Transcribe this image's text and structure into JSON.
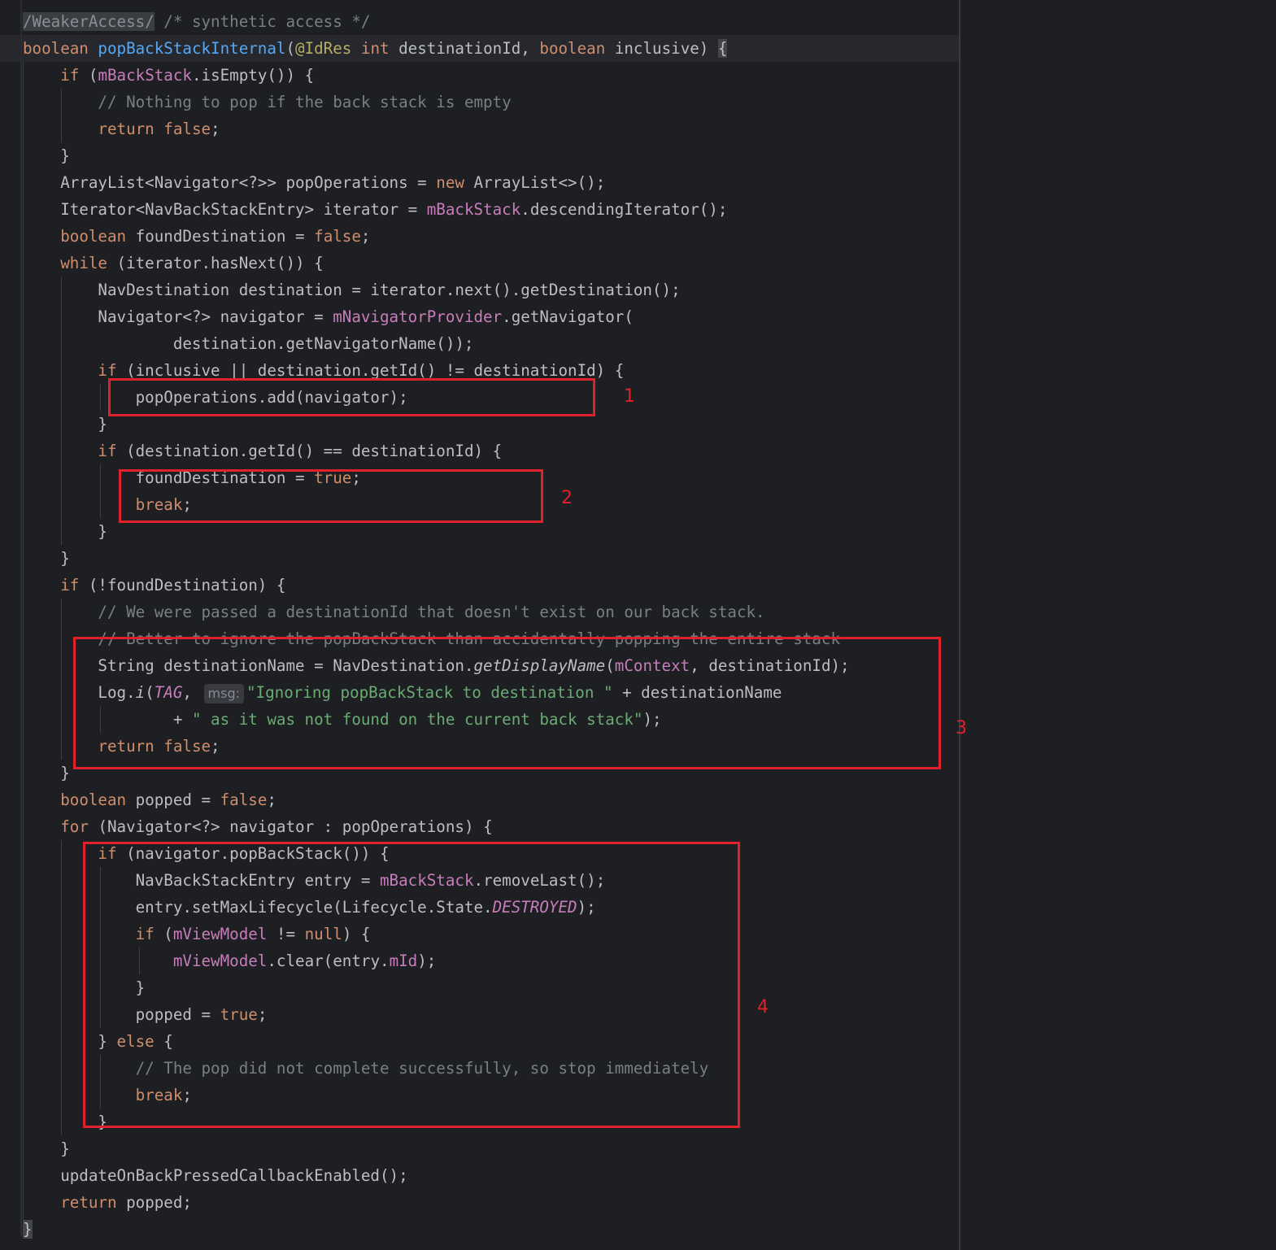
{
  "lines": [
    [
      [
        "hl-sup",
        "/WeakerAccess/"
      ],
      [
        "cmt",
        " /* synthetic access */"
      ]
    ],
    [
      [
        "kw",
        "boolean "
      ],
      [
        "fn",
        "popBackStackInternal"
      ],
      [
        "",
        "("
      ],
      [
        "ann",
        "@IdRes "
      ],
      [
        "kw",
        "int "
      ],
      [
        "",
        "destinationId, "
      ],
      [
        "kw",
        "boolean "
      ],
      [
        "",
        "inclusive) "
      ],
      [
        "brace-hl",
        "{"
      ]
    ],
    [
      [
        "",
        "    "
      ],
      [
        "kw",
        "if "
      ],
      [
        "",
        "("
      ],
      [
        "fld",
        "mBackStack"
      ],
      [
        "",
        ".isEmpty()) {"
      ]
    ],
    [
      [
        "",
        "        "
      ],
      [
        "cmt",
        "// Nothing to pop if the back stack is empty"
      ]
    ],
    [
      [
        "",
        "        "
      ],
      [
        "kw",
        "return false"
      ],
      [
        "",
        ";"
      ]
    ],
    [
      [
        "",
        "    }"
      ]
    ],
    [
      [
        "",
        "    ArrayList<Navigator<?>> popOperations = "
      ],
      [
        "kw",
        "new "
      ],
      [
        "",
        "ArrayList<>();"
      ]
    ],
    [
      [
        "",
        "    Iterator<NavBackStackEntry> iterator = "
      ],
      [
        "fld",
        "mBackStack"
      ],
      [
        "",
        ".descendingIterator();"
      ]
    ],
    [
      [
        "",
        "    "
      ],
      [
        "kw",
        "boolean "
      ],
      [
        "",
        "foundDestination = "
      ],
      [
        "kw",
        "false"
      ],
      [
        "",
        ";"
      ]
    ],
    [
      [
        "",
        "    "
      ],
      [
        "kw",
        "while "
      ],
      [
        "",
        "(iterator.hasNext()) {"
      ]
    ],
    [
      [
        "",
        "        NavDestination destination = iterator.next().getDestination();"
      ]
    ],
    [
      [
        "",
        "        Navigator<?> navigator = "
      ],
      [
        "fld",
        "mNavigatorProvider"
      ],
      [
        "",
        ".getNavigator("
      ]
    ],
    [
      [
        "",
        "                destination.getNavigatorName());"
      ]
    ],
    [
      [
        "",
        "        "
      ],
      [
        "kw",
        "if "
      ],
      [
        "",
        "(inclusive || destination.getId() != destinationId) {"
      ]
    ],
    [
      [
        "",
        "            popOperations.add(navigator);"
      ]
    ],
    [
      [
        "",
        "        }"
      ]
    ],
    [
      [
        "",
        "        "
      ],
      [
        "kw",
        "if "
      ],
      [
        "",
        "(destination.getId() == destinationId) {"
      ]
    ],
    [
      [
        "",
        "            foundDestination = "
      ],
      [
        "kw",
        "true"
      ],
      [
        "",
        ";"
      ]
    ],
    [
      [
        "",
        "            "
      ],
      [
        "kw",
        "break"
      ],
      [
        "",
        ";"
      ]
    ],
    [
      [
        "",
        "        }"
      ]
    ],
    [
      [
        "",
        "    }"
      ]
    ],
    [
      [
        "",
        "    "
      ],
      [
        "kw",
        "if "
      ],
      [
        "",
        "(!foundDestination) {"
      ]
    ],
    [
      [
        "",
        "        "
      ],
      [
        "cmt",
        "// We were passed a destinationId that doesn't exist on our back stack."
      ]
    ],
    [
      [
        "",
        "        "
      ],
      [
        "cmt",
        "// Better to ignore the popBackStack than accidentally popping the entire stack"
      ]
    ],
    [
      [
        "",
        "        String destinationName = NavDestination."
      ],
      [
        "it",
        "getDisplayName"
      ],
      [
        "",
        "("
      ],
      [
        "fld",
        "mContext"
      ],
      [
        "",
        ", destinationId);"
      ]
    ],
    [
      [
        "",
        "        Log."
      ],
      [
        "it",
        "i"
      ],
      [
        "",
        "("
      ],
      [
        "fld it",
        "TAG"
      ],
      [
        "",
        ", "
      ],
      [
        "hint",
        "msg:"
      ],
      [
        "str",
        "\"Ignoring popBackStack to destination \""
      ],
      [
        "",
        " + destinationName"
      ]
    ],
    [
      [
        "",
        "                + "
      ],
      [
        "str",
        "\" as it was not found on the current back stack\""
      ],
      [
        "",
        ");"
      ]
    ],
    [
      [
        "",
        "        "
      ],
      [
        "kw",
        "return false"
      ],
      [
        "",
        ";"
      ]
    ],
    [
      [
        "",
        "    }"
      ]
    ],
    [
      [
        "",
        "    "
      ],
      [
        "kw",
        "boolean "
      ],
      [
        "",
        "popped = "
      ],
      [
        "kw",
        "false"
      ],
      [
        "",
        ";"
      ]
    ],
    [
      [
        "",
        "    "
      ],
      [
        "kw",
        "for "
      ],
      [
        "",
        "(Navigator<?> navigator : popOperations) {"
      ]
    ],
    [
      [
        "",
        "        "
      ],
      [
        "kw",
        "if "
      ],
      [
        "",
        "(navigator.popBackStack()) {"
      ]
    ],
    [
      [
        "",
        "            NavBackStackEntry entry = "
      ],
      [
        "fld",
        "mBackStack"
      ],
      [
        "",
        ".removeLast();"
      ]
    ],
    [
      [
        "",
        "            entry.setMaxLifecycle(Lifecycle.State."
      ],
      [
        "fld it",
        "DESTROYED"
      ],
      [
        "",
        ");"
      ]
    ],
    [
      [
        "",
        "            "
      ],
      [
        "kw",
        "if "
      ],
      [
        "",
        "("
      ],
      [
        "fld",
        "mViewModel"
      ],
      [
        "",
        " != "
      ],
      [
        "kw",
        "null"
      ],
      [
        "",
        ") {"
      ]
    ],
    [
      [
        "",
        "                "
      ],
      [
        "fld",
        "mViewModel"
      ],
      [
        "",
        ".clear(entry."
      ],
      [
        "fld",
        "mId"
      ],
      [
        "",
        ");"
      ]
    ],
    [
      [
        "",
        "            }"
      ]
    ],
    [
      [
        "",
        "            popped = "
      ],
      [
        "kw",
        "true"
      ],
      [
        "",
        ";"
      ]
    ],
    [
      [
        "",
        "        } "
      ],
      [
        "kw",
        "else "
      ],
      [
        "",
        "{"
      ]
    ],
    [
      [
        "",
        "            "
      ],
      [
        "cmt",
        "// The pop did not complete successfully, so stop immediately"
      ]
    ],
    [
      [
        "",
        "            "
      ],
      [
        "kw",
        "break"
      ],
      [
        "",
        ";"
      ]
    ],
    [
      [
        "",
        "        }"
      ]
    ],
    [
      [
        "",
        "    }"
      ]
    ],
    [
      [
        "",
        "    updateOnBackPressedCallbackEnabled();"
      ]
    ],
    [
      [
        "",
        "    "
      ],
      [
        "kw",
        "return "
      ],
      [
        "",
        "popped;"
      ]
    ],
    [
      [
        "brace-hl",
        "}"
      ]
    ]
  ],
  "annotations": [
    "1",
    "2",
    "3",
    "4"
  ],
  "colors": {
    "background": "#1e1f22",
    "keyword": "#cf8e6d",
    "method": "#56a8f5",
    "field": "#c77dbb",
    "string": "#6aab73",
    "comment": "#7a7e85",
    "annotation": "#b3ae60",
    "marker": "#e0202a"
  }
}
